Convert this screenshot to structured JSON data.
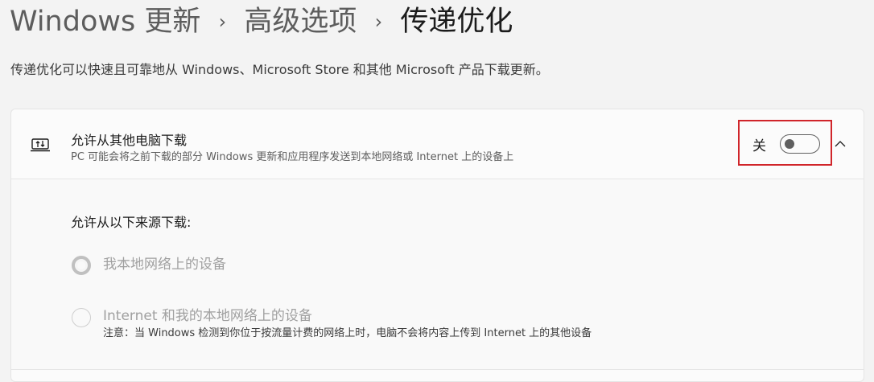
{
  "breadcrumb": {
    "items": [
      "Windows 更新",
      "高级选项",
      "传递优化"
    ],
    "separator": "›"
  },
  "description": "传递优化可以快速且可靠地从 Windows、Microsoft Store 和其他 Microsoft 产品下载更新。",
  "setting": {
    "icon": "download-transfer-icon",
    "title": "允许从其他电脑下载",
    "subtitle": "PC 可能会将之前下载的部分 Windows 更新和应用程序发送到本地网络或 Internet 上的设备上",
    "toggle_state_label": "关",
    "toggle_on": false,
    "expanded": true,
    "highlight_color": "#d0252a"
  },
  "sources": {
    "label": "允许从以下来源下载:",
    "options": [
      {
        "label": "我本地网络上的设备",
        "selected": true,
        "enabled": false
      },
      {
        "label": "Internet 和我的本地网络上的设备",
        "selected": false,
        "enabled": false,
        "note": "注意：当 Windows 检测到你位于按流量计费的网络上时，电脑不会将内容上传到 Internet 上的其他设备"
      }
    ]
  }
}
